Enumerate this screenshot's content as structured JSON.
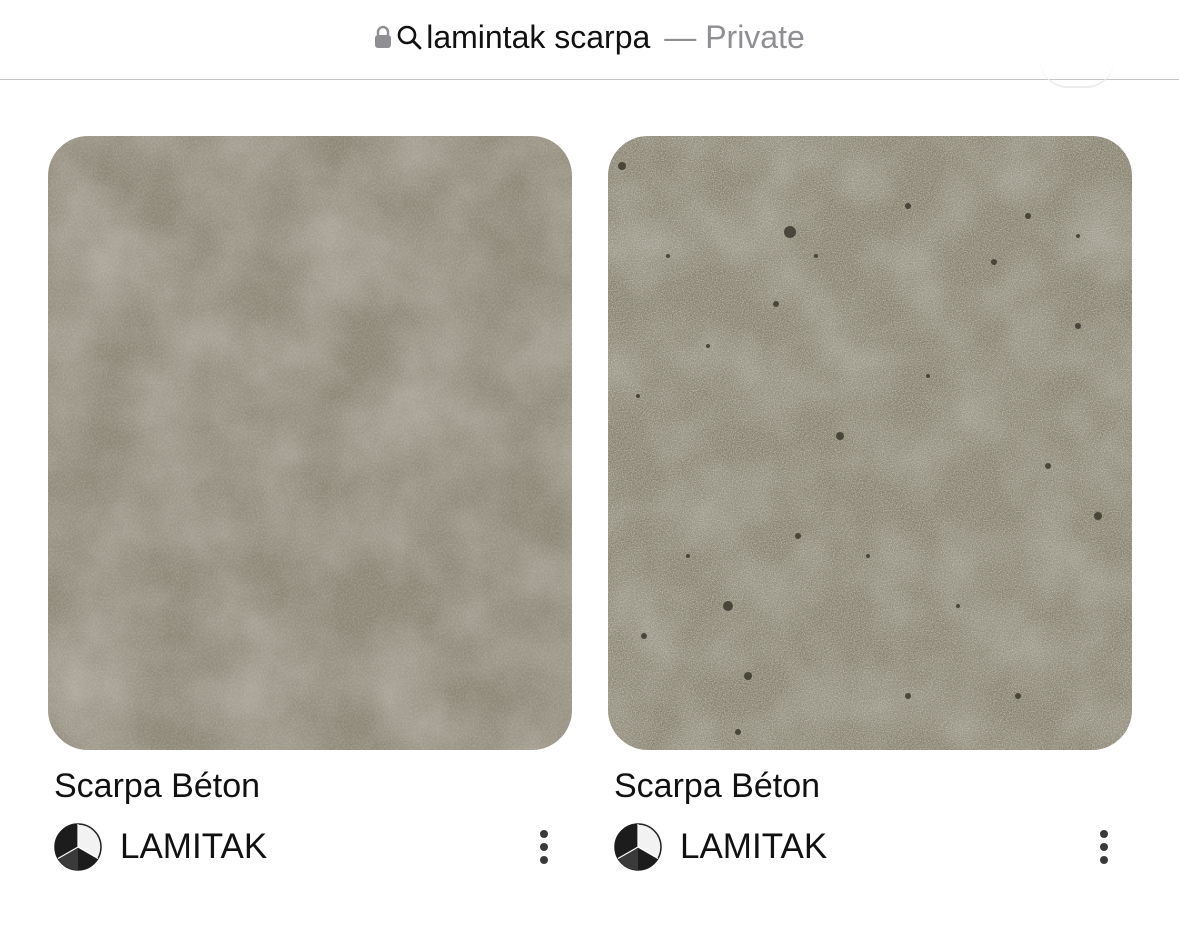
{
  "url_bar": {
    "query": "lamintak scarpa",
    "privacy_label": "— Private",
    "lock_icon": "lock-icon",
    "search_icon": "search-icon"
  },
  "pins": [
    {
      "title": "Scarpa Béton",
      "creator": "LAMITAK",
      "texture": "smooth-concrete",
      "colors": {
        "base": "#8e8878",
        "light": "#a8a393",
        "dark": "#7a7466"
      }
    },
    {
      "title": "Scarpa Béton",
      "creator": "LAMITAK",
      "texture": "speckled-concrete",
      "colors": {
        "base": "#87826f",
        "light": "#9d9886",
        "dark": "#3c372d"
      }
    }
  ]
}
